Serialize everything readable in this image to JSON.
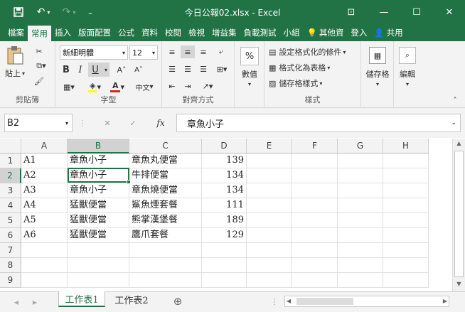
{
  "window": {
    "title": "今日公報02.xlsx - Excel"
  },
  "qat": {
    "save": "💾",
    "undo": "↶",
    "redo": "↷",
    "more": "₌"
  },
  "winctl": {
    "ribbon_opts": "⊡",
    "min": "—",
    "max": "☐",
    "close": "✕"
  },
  "tabs": [
    "檔案",
    "常用",
    "插入",
    "版面配置",
    "公式",
    "資料",
    "校閱",
    "檢視",
    "增益集",
    "負載測試",
    "小組"
  ],
  "tell": "其他資",
  "signin": "登入",
  "share": "共用",
  "ribbon": {
    "clipboard": {
      "label": "剪貼簿",
      "paste": "貼上"
    },
    "font": {
      "label": "字型",
      "name": "新細明體",
      "size": "12",
      "bold": "B",
      "italic": "I",
      "underline": "U",
      "grow": "A˄",
      "shrink": "A˅",
      "color_a": "A",
      "phonetic": "中文"
    },
    "align": {
      "label": "對齊方式"
    },
    "number": {
      "label": "數值",
      "pct": "%"
    },
    "styles": {
      "label": "樣式",
      "cond": "設定格式化的條件",
      "table": "格式化為表格",
      "cell": "儲存格樣式"
    },
    "cells": {
      "label": "儲存格"
    },
    "editing": {
      "label": "編輯"
    }
  },
  "formula": {
    "namebox": "B2",
    "fx": "fx",
    "content": "章魚小子",
    "cancel": "✕",
    "enter": "✓"
  },
  "grid": {
    "columns": [
      "A",
      "B",
      "C",
      "D",
      "E",
      "F",
      "G",
      "H"
    ],
    "rows": [
      "1",
      "2",
      "3",
      "4",
      "5",
      "6",
      "7",
      "8",
      "9"
    ],
    "cells": [
      [
        "A1",
        "章魚小子",
        "章魚丸便當",
        "139"
      ],
      [
        "A2",
        "章魚小子",
        "牛排便當",
        "134"
      ],
      [
        "A3",
        "章魚小子",
        "章魚燒便當",
        "134"
      ],
      [
        "A4",
        "猛獸便當",
        "鯊魚煙套餐",
        "111"
      ],
      [
        "A5",
        "猛獸便當",
        "熊掌漢堡餐",
        "189"
      ],
      [
        "A6",
        "猛獸便當",
        "鷹爪套餐",
        "129"
      ]
    ],
    "selected": "B2"
  },
  "sheets": {
    "tabs": [
      "工作表1",
      "工作表2"
    ],
    "active": "工作表1",
    "add": "⊕"
  },
  "colors": {
    "accent": "#217346"
  }
}
